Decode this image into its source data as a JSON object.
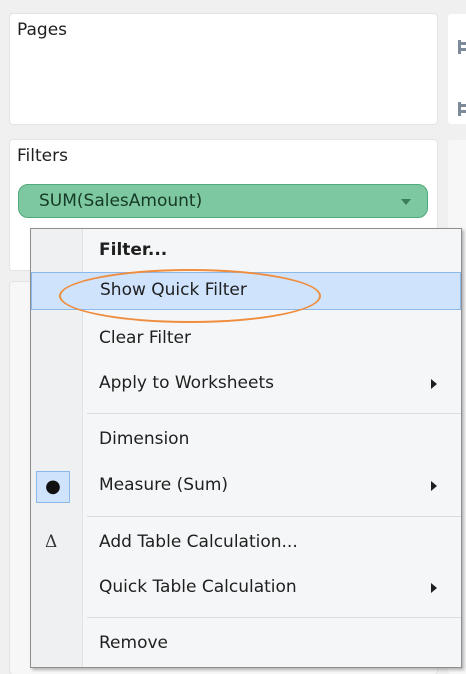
{
  "shelves": {
    "pages_title": "Pages",
    "filters_title": "Filters"
  },
  "filter_pill": {
    "label": "SUM(SalesAmount)",
    "color": "#7dc8a0"
  },
  "context_menu": {
    "items": [
      {
        "label": "Filter...",
        "bold": true
      },
      {
        "label": "Show Quick Filter",
        "highlighted": true
      },
      {
        "label": "Clear Filter"
      },
      {
        "label": "Apply to Worksheets",
        "submenu": true
      },
      {
        "label": "Dimension"
      },
      {
        "label": "Measure (Sum)",
        "checked": true,
        "check_glyph": "●",
        "submenu": true
      },
      {
        "label": "Add Table Calculation...",
        "icon": "delta-icon",
        "icon_glyph": "Δ"
      },
      {
        "label": "Quick Table Calculation",
        "submenu": true
      },
      {
        "label": "Remove"
      }
    ]
  },
  "colors": {
    "highlight": "#cfe3fc",
    "annotation": "#ef8d3e"
  }
}
